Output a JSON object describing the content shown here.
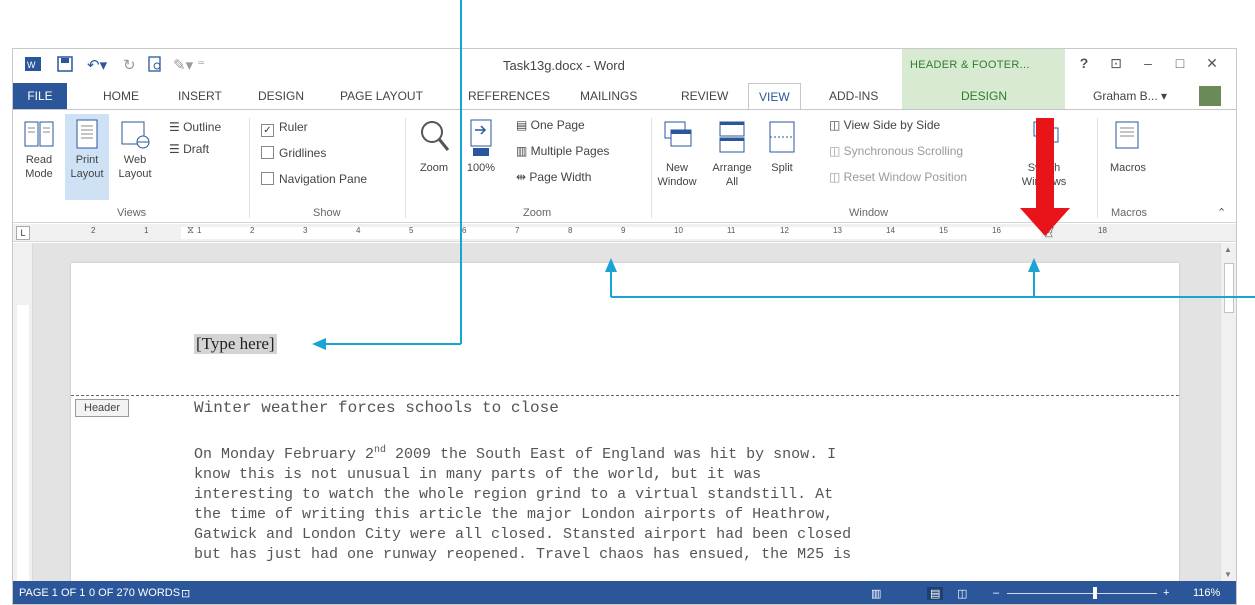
{
  "window": {
    "title": "Task13g.docx - Word",
    "contextual_tab": "HEADER & FOOTER...",
    "help": "?",
    "user": "Graham B..."
  },
  "tabs": [
    "FILE",
    "HOME",
    "INSERT",
    "DESIGN",
    "PAGE LAYOUT",
    "REFERENCES",
    "MAILINGS",
    "REVIEW",
    "VIEW",
    "ADD-INS",
    "DESIGN"
  ],
  "ribbon": {
    "views": {
      "label": "Views",
      "read_mode": "Read\nMode",
      "print_layout": "Print\nLayout",
      "web_layout": "Web\nLayout",
      "outline": "Outline",
      "draft": "Draft"
    },
    "show": {
      "label": "Show",
      "ruler": "Ruler",
      "gridlines": "Gridlines",
      "navigation_pane": "Navigation Pane",
      "ruler_checked": true
    },
    "zoom": {
      "label": "Zoom",
      "zoom": "Zoom",
      "zoom_100": "100%",
      "one_page": "One Page",
      "multiple_pages": "Multiple Pages",
      "page_width": "Page Width"
    },
    "window": {
      "label": "Window",
      "new_window": "New\nWindow",
      "arrange_all": "Arrange\nAll",
      "split": "Split",
      "side_by_side": "View Side by Side",
      "sync_scrolling": "Synchronous Scrolling",
      "reset_position": "Reset Window Position",
      "switch_windows": "Switch\nWindows"
    },
    "macros": {
      "label": "Macros",
      "macros": "Macros"
    }
  },
  "ruler_numbers": [
    "2",
    "1",
    "1",
    "2",
    "3",
    "4",
    "5",
    "6",
    "7",
    "8",
    "9",
    "10",
    "11",
    "12",
    "13",
    "14",
    "15",
    "16",
    "17",
    "18"
  ],
  "document": {
    "placeholder": "[Type here]",
    "header_tag": "Header",
    "title": "Winter weather forces schools to close",
    "body_lines": [
      "On Monday February 2|nd| 2009 the South East of England was hit by snow. I",
      "know this is not unusual in many parts of the world, but it was",
      "interesting to watch the whole region grind to a virtual standstill. At",
      "the time of writing this article the major London airports of Heathrow,",
      "Gatwick and London City were all closed. Stansted airport had been closed",
      "but has just had one runway reopened. Travel chaos has ensued, the M25 is"
    ]
  },
  "status": {
    "page": "PAGE 1 OF 1",
    "words": "0 OF 270 WORDS",
    "zoom": "116%"
  },
  "colors": {
    "accent": "#2b579a",
    "contextual": "#d8ebd2",
    "annotation": "#1aa3d5",
    "arrow": "#e8141a"
  }
}
